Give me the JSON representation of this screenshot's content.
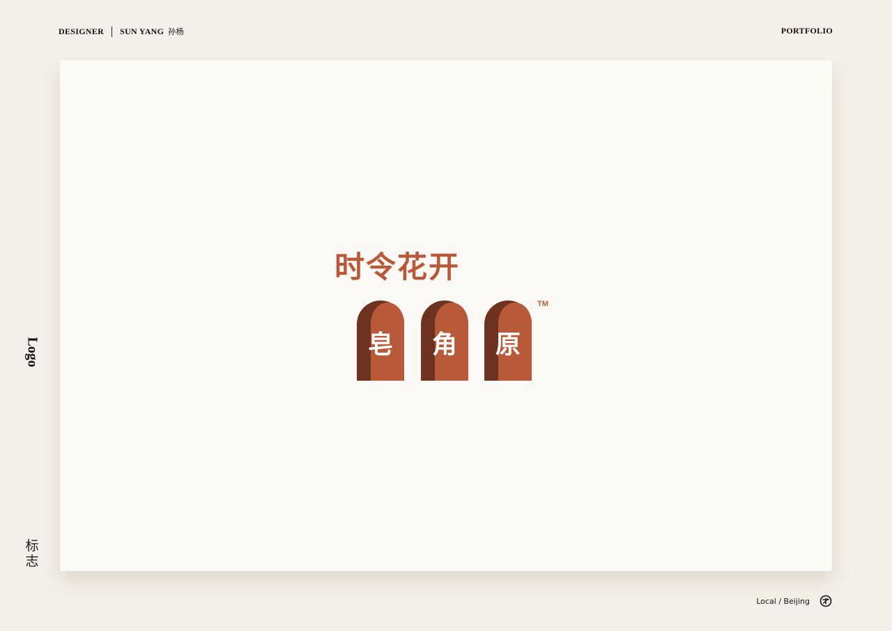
{
  "header": {
    "designer_label": "DESIGNER",
    "designer_name": "SUN YANG",
    "designer_name_cn": "孙杨",
    "portfolio_label": "PORTFOLIO"
  },
  "side": {
    "category_en": "Logo",
    "category_cn": "标志"
  },
  "logo": {
    "title": "时令花开",
    "tm": "TM",
    "chars": [
      "皂",
      "角",
      "原"
    ]
  },
  "footer": {
    "location": "Local / Beijing",
    "icon": "stamp-icon"
  },
  "colors": {
    "background": "#f4f0e9",
    "card": "#fbf9f6",
    "brand": "#b85a3a",
    "brand_dark": "#6e3220"
  }
}
